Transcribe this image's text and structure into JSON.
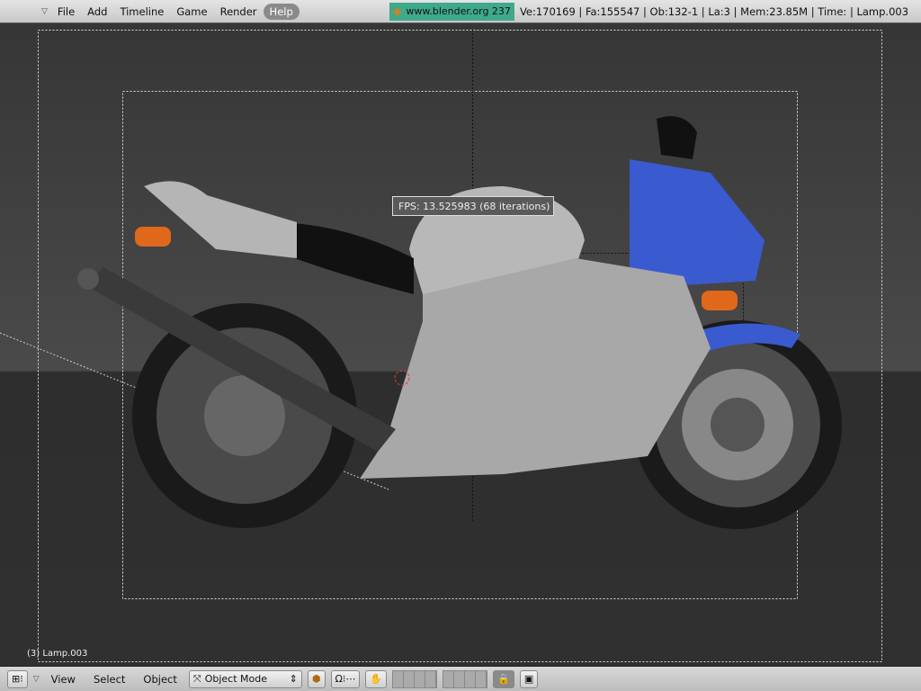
{
  "menu": {
    "items": [
      "File",
      "Add",
      "Timeline",
      "Game",
      "Render",
      "Help"
    ],
    "active": "Help"
  },
  "header": {
    "site": "www.blender.org 237",
    "stats": "Ve:170169 | Fa:155547 | Ob:132-1 | La:3 | Mem:23.85M | Time: | Lamp.003"
  },
  "viewport": {
    "fps": "FPS: 13.525983 (68 iterations)",
    "object_label": "(3) Lamp.003",
    "body_color": "#3a5ad0"
  },
  "bottom": {
    "view": "View",
    "select": "Select",
    "object": "Object",
    "mode": "Object Mode"
  }
}
